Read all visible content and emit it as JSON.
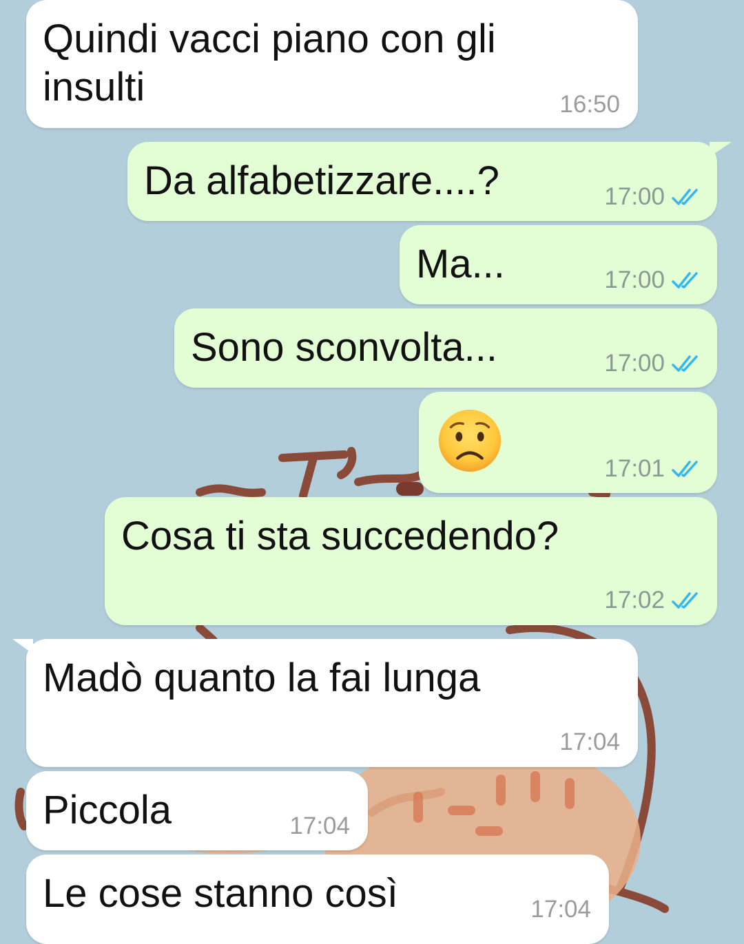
{
  "colors": {
    "background": "#b3cedb",
    "incoming_bubble": "#ffffff",
    "outgoing_bubble": "#e3fdd5",
    "read_ticks": "#34b7f1"
  },
  "messages": [
    {
      "direction": "incoming",
      "lines": [
        "Quindi vacci piano con gli",
        "insulti"
      ],
      "time": "16:50"
    },
    {
      "direction": "outgoing",
      "text": "Da alfabetizzare....?",
      "time": "17:00",
      "status": "read-ticks-icon"
    },
    {
      "direction": "outgoing",
      "text": "Ma...",
      "time": "17:00",
      "status": "read-ticks-icon"
    },
    {
      "direction": "outgoing",
      "text": "Sono sconvolta...",
      "time": "17:00",
      "status": "read-ticks-icon"
    },
    {
      "direction": "outgoing",
      "emoji": "worried-face-emoji",
      "time": "17:01",
      "status": "read-ticks-icon"
    },
    {
      "direction": "outgoing",
      "text": "Cosa ti sta succedendo?",
      "time": "17:02",
      "status": "read-ticks-icon"
    },
    {
      "direction": "incoming",
      "text": "Madò quanto la fai lunga",
      "time": "17:04"
    },
    {
      "direction": "incoming",
      "text": "Piccola",
      "time": "17:04"
    },
    {
      "direction": "incoming",
      "text": "Le cose stanno così",
      "time": "17:04"
    }
  ]
}
